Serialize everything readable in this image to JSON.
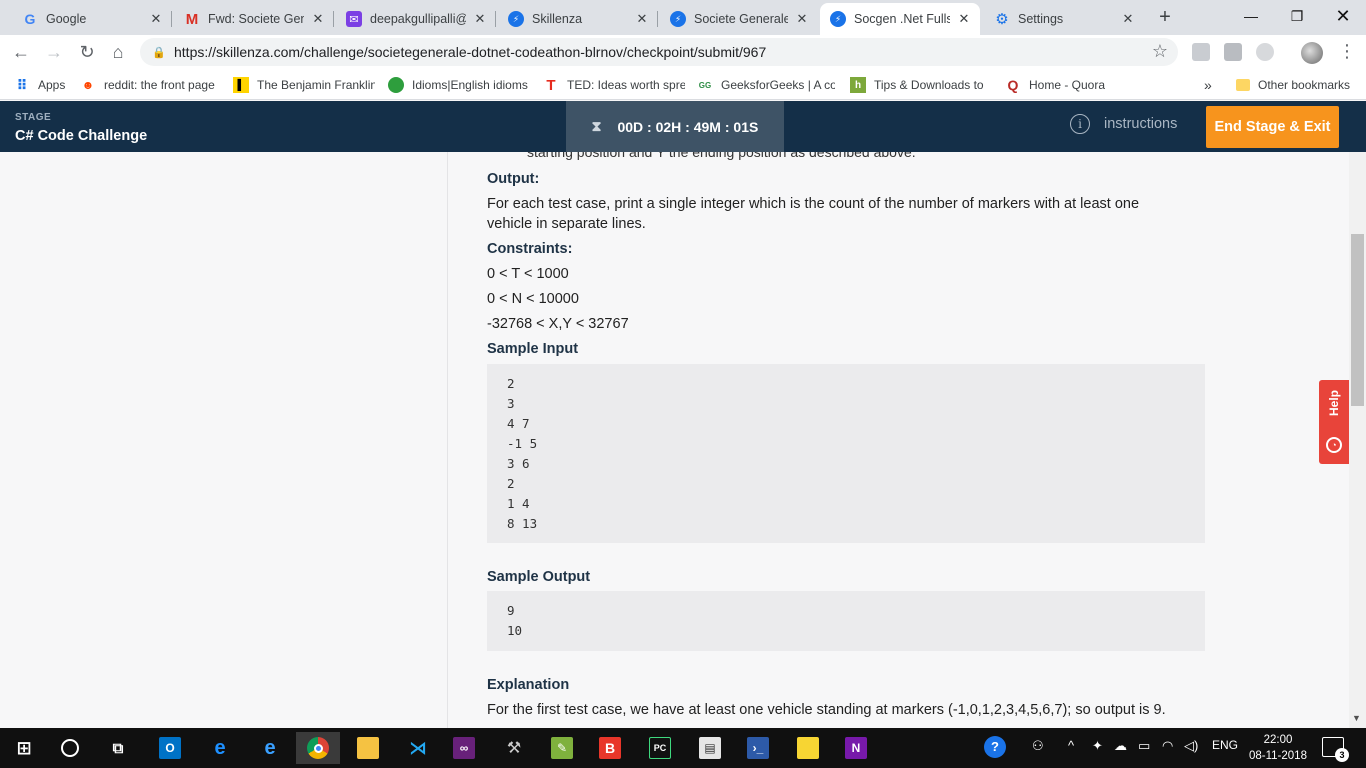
{
  "browser": {
    "tabs": [
      {
        "title": "Google",
        "icon": "google-icon"
      },
      {
        "title": "Fwd: Societe Gene",
        "icon": "gmail-icon"
      },
      {
        "title": "deepakgullipalli@",
        "icon": "email-icon"
      },
      {
        "title": "Skillenza",
        "icon": "skillenza-icon"
      },
      {
        "title": "Societe Generale C",
        "icon": "skillenza-icon"
      },
      {
        "title": "Socgen .Net Fullst",
        "icon": "skillenza-icon",
        "active": true
      },
      {
        "title": "Settings",
        "icon": "gear-icon"
      }
    ],
    "url": "https://skillenza.com/challenge/societegenerale-dotnet-codeathon-blrnov/checkpoint/submit/967",
    "bookmarks": [
      {
        "label": "Apps"
      },
      {
        "label": "reddit: the front page"
      },
      {
        "label": "The Benjamin Franklin"
      },
      {
        "label": "Idioms|English idioms"
      },
      {
        "label": "TED: Ideas worth spre"
      },
      {
        "label": "GeeksforGeeks | A co"
      },
      {
        "label": "Tips & Downloads to"
      },
      {
        "label": "Home - Quora"
      }
    ],
    "bookmarks_overflow": "»",
    "other_bookmarks": "Other bookmarks"
  },
  "header": {
    "stage_label": "STAGE",
    "stage_name": "C# Code Challenge",
    "timer": "00D : 02H : 49M : 01S",
    "instructions_label": "instructions",
    "end_button_label": "End Stage & Exit"
  },
  "content": {
    "cut_line": "starting position and Y the ending position as described above.",
    "output_heading": "Output:",
    "output_text": "For each test case, print a single integer which is the count of the number of markers with at least one vehicle in separate lines.",
    "constraints_heading": "Constraints:",
    "constraints": [
      "0 < T < 1000",
      "0 < N < 10000",
      "-32768 < X,Y < 32767"
    ],
    "sample_input_heading": "Sample Input",
    "sample_input": [
      "2",
      "3",
      "4 7",
      "-1 5",
      "3 6",
      "2",
      "1 4",
      "8 13"
    ],
    "sample_output_heading": "Sample Output",
    "sample_output": [
      "9",
      "10"
    ],
    "explanation_heading": "Explanation",
    "explanation_text": "For the first test case, we have at least one vehicle standing at markers (-1,0,1,2,3,4,5,6,7); so output is 9."
  },
  "help": {
    "label": "Help"
  },
  "taskbar": {
    "language": "ENG",
    "time": "22:00",
    "date": "08-11-2018",
    "notifications": "3"
  },
  "colors": {
    "header_bg": "#142f48",
    "timer_bg": "#3e5366",
    "end_button": "#f7941d",
    "help_tab": "#e8443a"
  }
}
